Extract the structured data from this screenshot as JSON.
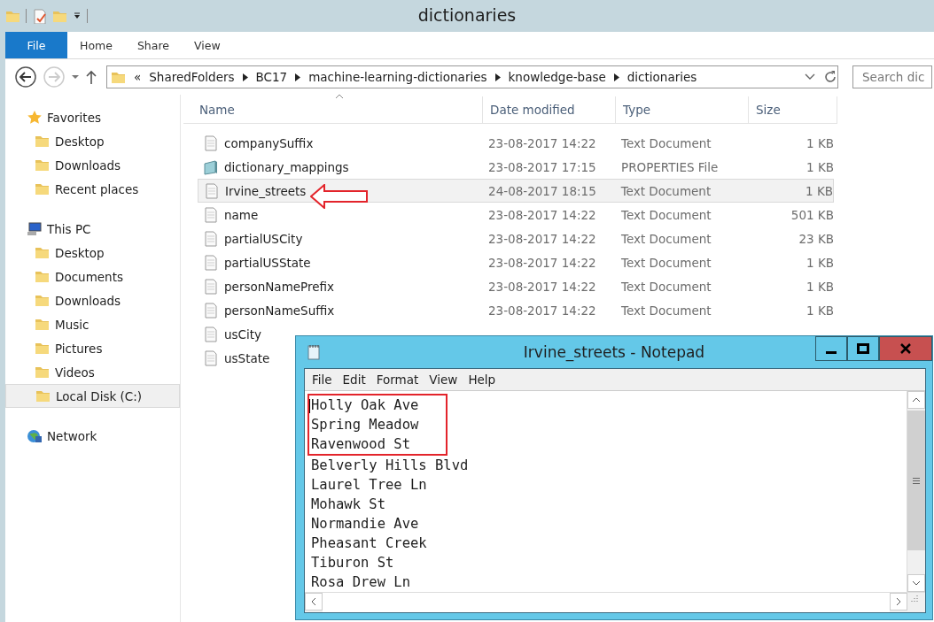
{
  "window": {
    "title": "dictionaries"
  },
  "ribbon_tabs": [
    {
      "label": "File",
      "selected": true
    },
    {
      "label": "Home",
      "selected": false
    },
    {
      "label": "Share",
      "selected": false
    },
    {
      "label": "View",
      "selected": false
    }
  ],
  "address_bar": {
    "overflow": "«",
    "segments": [
      "SharedFolders",
      "BC17",
      "machine-learning-dictionaries",
      "knowledge-base",
      "dictionaries"
    ]
  },
  "search": {
    "placeholder": "Search dic"
  },
  "sidebar": {
    "groups": [
      {
        "label": "Favorites",
        "children": [
          {
            "label": "Desktop",
            "selected": false
          },
          {
            "label": "Downloads",
            "selected": false
          },
          {
            "label": "Recent places",
            "selected": false
          }
        ]
      },
      {
        "label": "This PC",
        "children": [
          {
            "label": "Desktop",
            "selected": false
          },
          {
            "label": "Documents",
            "selected": false
          },
          {
            "label": "Downloads",
            "selected": false
          },
          {
            "label": "Music",
            "selected": false
          },
          {
            "label": "Pictures",
            "selected": false
          },
          {
            "label": "Videos",
            "selected": false
          },
          {
            "label": "Local Disk (C:)",
            "selected": true
          }
        ]
      },
      {
        "label": "Network"
      }
    ]
  },
  "table": {
    "columns": [
      "Name",
      "Date modified",
      "Type",
      "Size"
    ],
    "rows": [
      {
        "kind": "text",
        "name": "companySuffix",
        "date": "23-08-2017 14:22",
        "type": "Text Document",
        "size": "1 KB",
        "selected": false
      },
      {
        "kind": "properties",
        "name": "dictionary_mappings",
        "date": "23-08-2017 17:15",
        "type": "PROPERTIES File",
        "size": "1 KB",
        "selected": false
      },
      {
        "kind": "text",
        "name": "Irvine_streets",
        "date": "24-08-2017 18:15",
        "type": "Text Document",
        "size": "1 KB",
        "selected": true
      },
      {
        "kind": "text",
        "name": "name",
        "date": "23-08-2017 14:22",
        "type": "Text Document",
        "size": "501 KB",
        "selected": false
      },
      {
        "kind": "text",
        "name": "partialUSCity",
        "date": "23-08-2017 14:22",
        "type": "Text Document",
        "size": "23 KB",
        "selected": false
      },
      {
        "kind": "text",
        "name": "partialUSState",
        "date": "23-08-2017 14:22",
        "type": "Text Document",
        "size": "1 KB",
        "selected": false
      },
      {
        "kind": "text",
        "name": "personNamePrefix",
        "date": "23-08-2017 14:22",
        "type": "Text Document",
        "size": "1 KB",
        "selected": false
      },
      {
        "kind": "text",
        "name": "personNameSuffix",
        "date": "23-08-2017 14:22",
        "type": "Text Document",
        "size": "1 KB",
        "selected": false
      },
      {
        "kind": "text",
        "name": "usCity",
        "selected": false
      },
      {
        "kind": "text",
        "name": "usState",
        "selected": false
      }
    ]
  },
  "notepad": {
    "title": "Irvine_streets - Notepad",
    "menu": [
      "File",
      "Edit",
      "Format",
      "View",
      "Help"
    ],
    "highlighted_lines": [
      "Holly Oak Ave",
      "Spring Meadow",
      "Ravenwood St"
    ],
    "lines": [
      "Belverly Hills Blvd",
      "Laurel Tree Ln",
      "Mohawk St",
      "Normandie Ave",
      "Pheasant Creek",
      "Tiburon St",
      "Rosa Drew Ln"
    ]
  }
}
